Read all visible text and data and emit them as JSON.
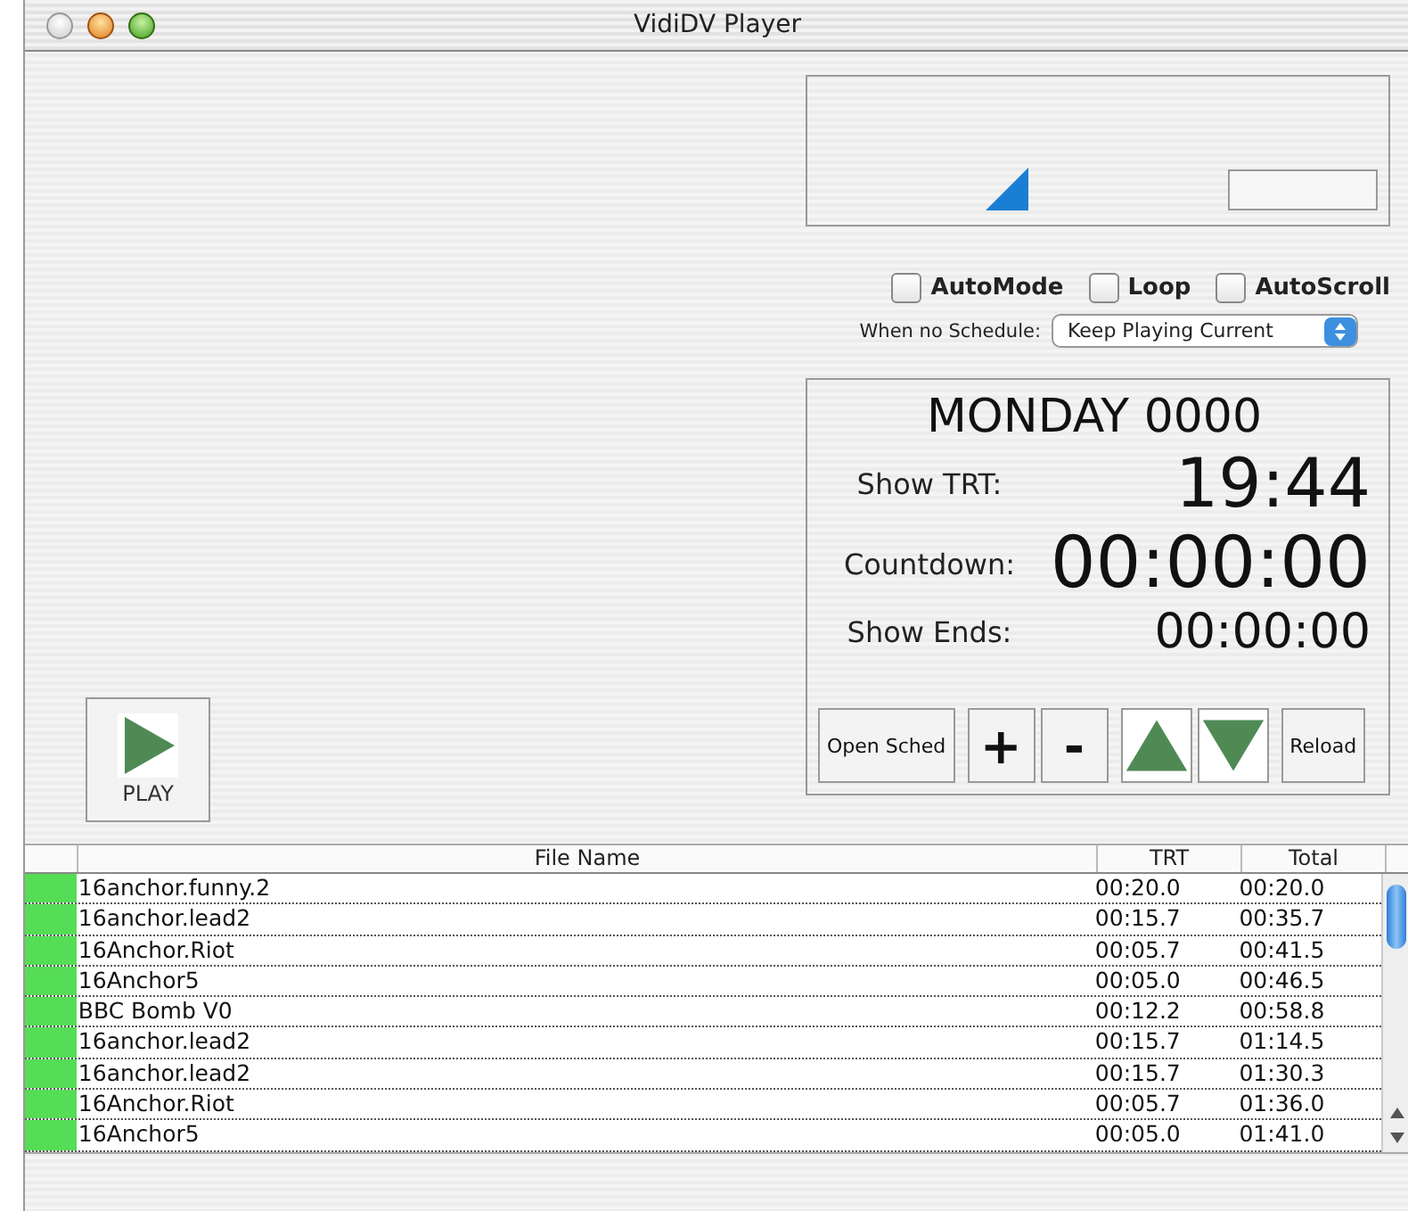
{
  "window": {
    "title": "VidiDV Player"
  },
  "options": [
    {
      "label": "AutoMode",
      "checked": false
    },
    {
      "label": "Loop",
      "checked": false
    },
    {
      "label": "AutoScroll",
      "checked": false
    }
  ],
  "no_schedule": {
    "label": "When no Schedule:",
    "value": "Keep Playing Current"
  },
  "clock": {
    "day": "MONDAY 0000",
    "rows": [
      {
        "label": "Show TRT:",
        "value": "19:44",
        "kind": "large"
      },
      {
        "label": "Countdown:",
        "value": "00:00:00",
        "kind": "huge"
      },
      {
        "label": "Show Ends:",
        "value": "00:00:00",
        "kind": "medium"
      }
    ]
  },
  "controls": [
    {
      "kind": "text",
      "label": "Open Sched"
    },
    {
      "kind": "symbol",
      "label": "+"
    },
    {
      "kind": "symbol",
      "label": "-"
    },
    {
      "kind": "up"
    },
    {
      "kind": "down"
    },
    {
      "kind": "text",
      "label": "Reload"
    }
  ],
  "play_button": {
    "label": "PLAY"
  },
  "table": {
    "columns": [
      "File Name",
      "TRT",
      "Total"
    ],
    "rows": [
      {
        "color": "#55dd55",
        "name": "16anchor.funny.2",
        "trt": "00:20.0",
        "total": "00:20.0"
      },
      {
        "color": "#55dd55",
        "name": "16anchor.lead2",
        "trt": "00:15.7",
        "total": "00:35.7"
      },
      {
        "color": "#55dd55",
        "name": "16Anchor.Riot",
        "trt": "00:05.7",
        "total": "00:41.5"
      },
      {
        "color": "#55dd55",
        "name": "16Anchor5",
        "trt": "00:05.0",
        "total": "00:46.5"
      },
      {
        "color": "#55dd55",
        "name": "BBC Bomb V0",
        "trt": "00:12.2",
        "total": "00:58.8"
      },
      {
        "color": "#55dd55",
        "name": "16anchor.lead2",
        "trt": "00:15.7",
        "total": "01:14.5"
      },
      {
        "color": "#55dd55",
        "name": "16anchor.lead2",
        "trt": "00:15.7",
        "total": "01:30.3"
      },
      {
        "color": "#55dd55",
        "name": "16Anchor.Riot",
        "trt": "00:05.7",
        "total": "01:36.0"
      },
      {
        "color": "#55dd55",
        "name": "16Anchor5",
        "trt": "00:05.0",
        "total": "01:41.0"
      }
    ]
  }
}
